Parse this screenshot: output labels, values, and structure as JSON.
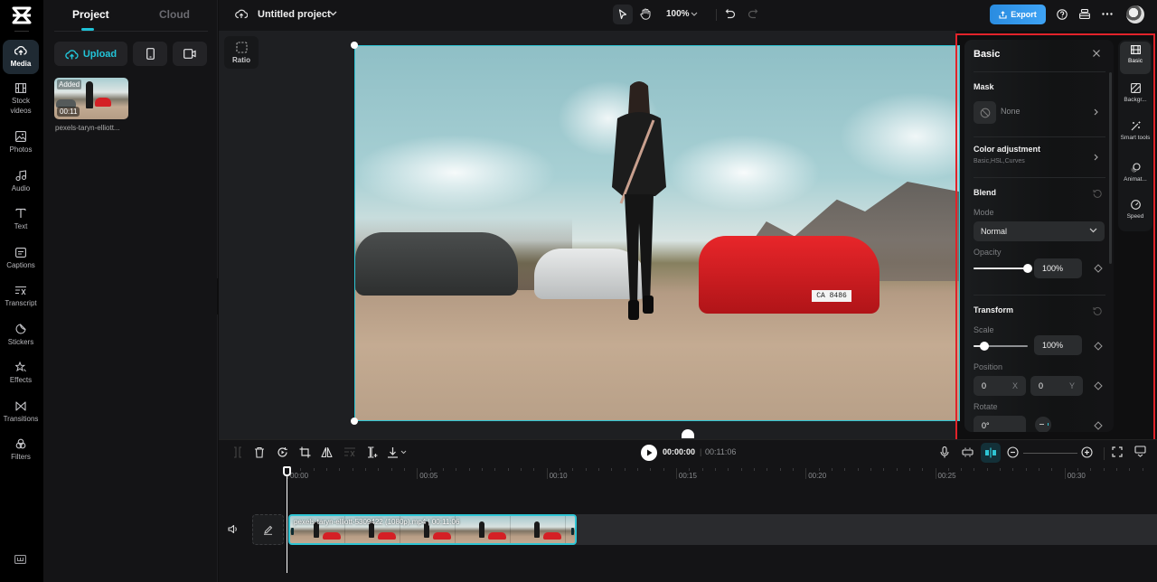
{
  "app": {
    "brand_icon": "capcut-logo-icon"
  },
  "rail": {
    "items": [
      {
        "label": "Media",
        "icon": "cloud-upload-icon",
        "active": true
      },
      {
        "label": "Stock videos",
        "icon": "film-icon"
      },
      {
        "label": "Photos",
        "icon": "image-icon"
      },
      {
        "label": "Audio",
        "icon": "music-note-icon"
      },
      {
        "label": "Text",
        "icon": "text-icon"
      },
      {
        "label": "Captions",
        "icon": "captions-icon"
      },
      {
        "label": "Transcript",
        "icon": "transcript-icon"
      },
      {
        "label": "Stickers",
        "icon": "sticker-icon"
      },
      {
        "label": "Effects",
        "icon": "effects-star-icon"
      },
      {
        "label": "Transitions",
        "icon": "transitions-icon"
      },
      {
        "label": "Filters",
        "icon": "filters-icon"
      }
    ],
    "bottom_icon": "keyboard-shortcuts-icon"
  },
  "media_panel": {
    "tabs": [
      {
        "label": "Project",
        "active": true
      },
      {
        "label": "Cloud",
        "active": false
      }
    ],
    "upload_label": "Upload",
    "phone_icon": "phone-icon",
    "record_icon": "camera-record-icon",
    "items": [
      {
        "badge": "Added",
        "duration": "00:11",
        "name": "pexels-taryn-elliott..."
      }
    ]
  },
  "topbar": {
    "project_title": "Untitled project",
    "zoom": "100%",
    "export_label": "Export"
  },
  "stage": {
    "ratio_label": "Ratio",
    "plate_text": "CA 8486"
  },
  "inspector": {
    "title": "Basic",
    "mask": {
      "title": "Mask",
      "value": "None"
    },
    "color_adjustment": {
      "title": "Color adjustment",
      "subtitle": "Basic,HSL,Curves"
    },
    "blend": {
      "title": "Blend",
      "mode_label": "Mode",
      "mode_value": "Normal",
      "opacity_label": "Opacity",
      "opacity_value": "100%",
      "opacity_fraction": 1.0
    },
    "transform": {
      "title": "Transform",
      "scale_label": "Scale",
      "scale_value": "100%",
      "scale_fraction": 0.2,
      "position_label": "Position",
      "position_x": "0",
      "position_x_suffix": "X",
      "position_y": "0",
      "position_y_suffix": "Y",
      "rotate_label": "Rotate",
      "rotate_value": "0°"
    }
  },
  "right_tabs": [
    {
      "label": "Basic",
      "icon": "basic-film-icon",
      "active": true
    },
    {
      "label": "Backgr...",
      "icon": "background-icon"
    },
    {
      "label": "Smart tools",
      "icon": "magic-wand-icon"
    },
    {
      "label": "Animat...",
      "icon": "animation-icon"
    },
    {
      "label": "Speed",
      "icon": "speedometer-icon"
    }
  ],
  "timeline": {
    "current_time": "00:00:00",
    "separator": "|",
    "total_time": "00:11:06",
    "ruler": [
      "00:00",
      "00:05",
      "00:10",
      "00:15",
      "00:20",
      "00:25",
      "00:30"
    ],
    "clip": {
      "name": "pexels-taryn-elliott-5309422 (1080p).mp4",
      "duration": "00:11:06"
    }
  }
}
